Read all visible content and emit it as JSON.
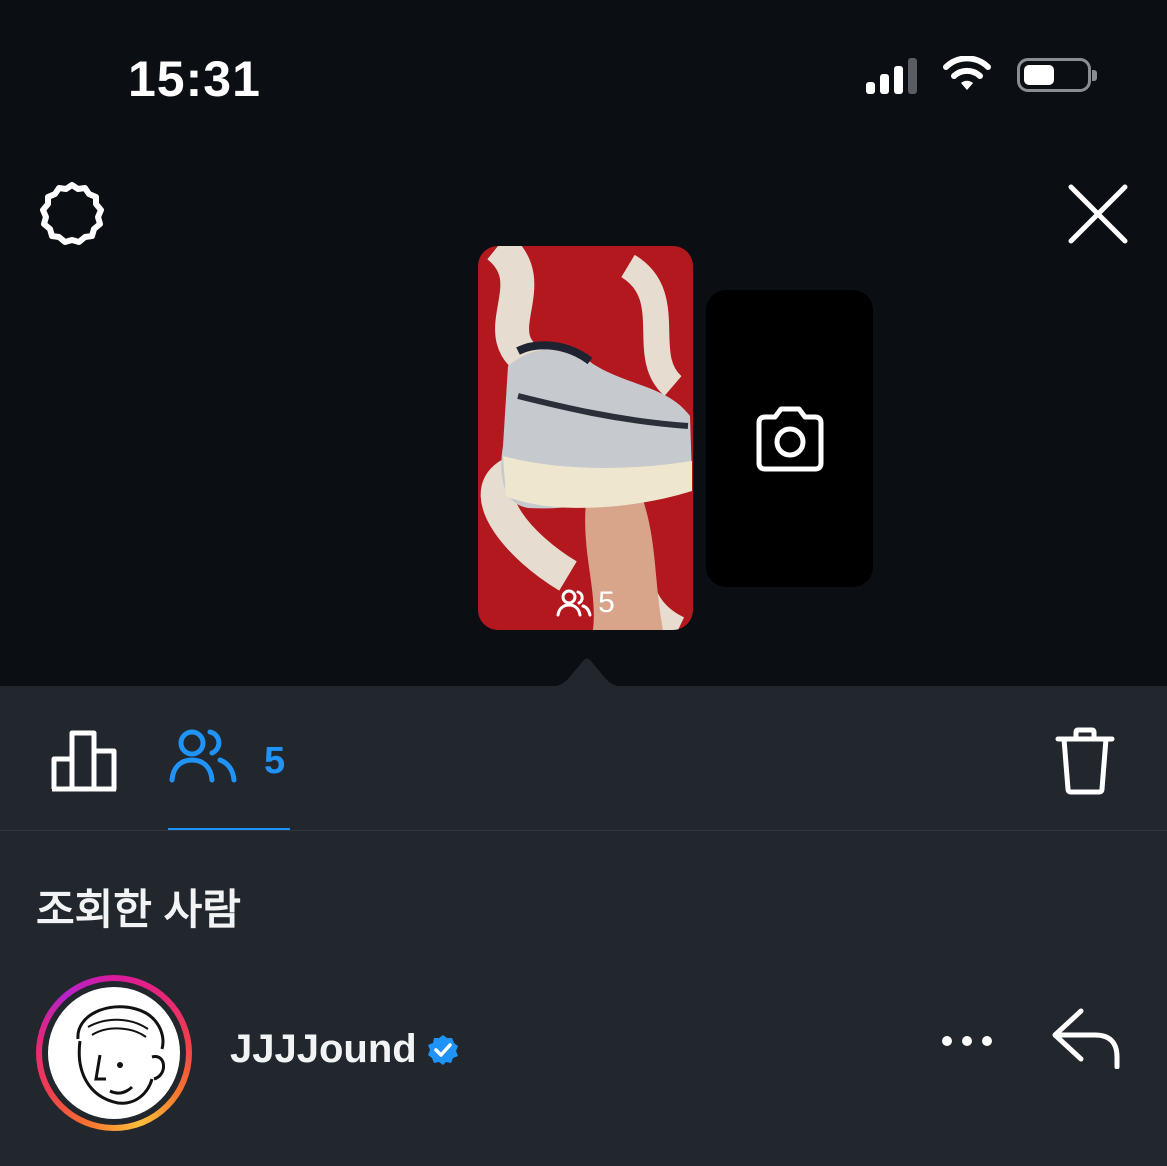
{
  "status_bar": {
    "time": "15:31"
  },
  "story": {
    "viewer_count": "5"
  },
  "tabs": {
    "viewers_count": "5"
  },
  "section": {
    "title": "조회한 사람"
  },
  "viewers": [
    {
      "username": "JJJJound",
      "verified": true
    }
  ],
  "colors": {
    "accent": "#1f93f7",
    "panel": "#22262d",
    "background": "#0b0e13"
  },
  "icons": [
    "settings-icon",
    "close-icon",
    "camera-icon",
    "viewers-icon",
    "bar-chart-icon",
    "trash-icon",
    "more-icon",
    "reply-icon",
    "verified-icon"
  ]
}
